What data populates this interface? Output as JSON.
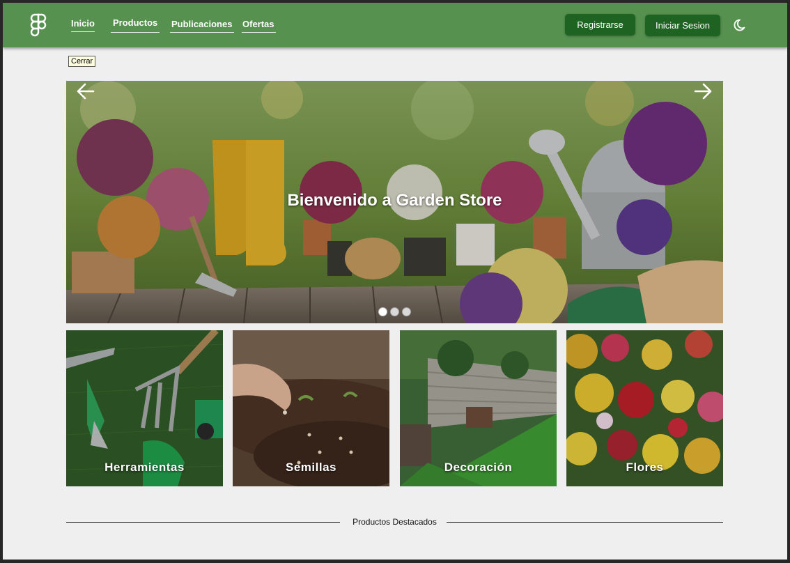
{
  "nav": {
    "links": [
      {
        "label": "Inicio"
      },
      {
        "label": "Productos"
      },
      {
        "label": "Publicaciones"
      },
      {
        "label": "Ofertas"
      }
    ],
    "register_label": "Registrarse",
    "login_label": "Iniciar Sesion",
    "theme_icon": "moon-icon"
  },
  "tooltip": "Cerrar",
  "hero": {
    "title": "Bienvenido a Garden Store",
    "slides_count": 3,
    "active_slide": 1
  },
  "categories": [
    {
      "label": "Herramientas"
    },
    {
      "label": "Semillas"
    },
    {
      "label": "Decoración"
    },
    {
      "label": "Flores"
    }
  ],
  "featured": {
    "label": "Productos Destacados"
  },
  "colors": {
    "header": "#56914f",
    "button": "#1f6322",
    "page": "#efefef"
  }
}
